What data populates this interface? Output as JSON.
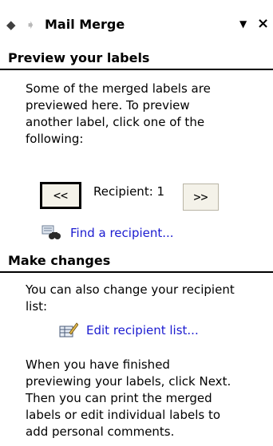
{
  "pane": {
    "title": "Mail Merge",
    "back_icon": "back-arrow-icon",
    "forward_icon": "forward-arrow-icon",
    "menu_icon": "dropdown-triangle-icon",
    "close_glyph": "×"
  },
  "preview": {
    "header": "Preview your labels",
    "lines": [
      "Some of the merged labels are",
      "previewed here. To preview",
      "another label, click one of the",
      "following:"
    ],
    "prev_label": "<<",
    "recipient_label": "Recipient: 1",
    "next_label": ">>",
    "find_link": "Find a recipient..."
  },
  "changes": {
    "header": "Make changes",
    "lines": [
      "You can also change your recipient",
      "list:"
    ],
    "edit_link": "Edit recipient list...",
    "footer_lines": [
      "When you have finished",
      "previewing your labels, click Next.",
      "Then you can print the merged",
      "labels or edit individual labels to",
      "add personal comments."
    ]
  },
  "colors": {
    "link": "#1b1bd0",
    "button_face": "#f4f2e9"
  }
}
